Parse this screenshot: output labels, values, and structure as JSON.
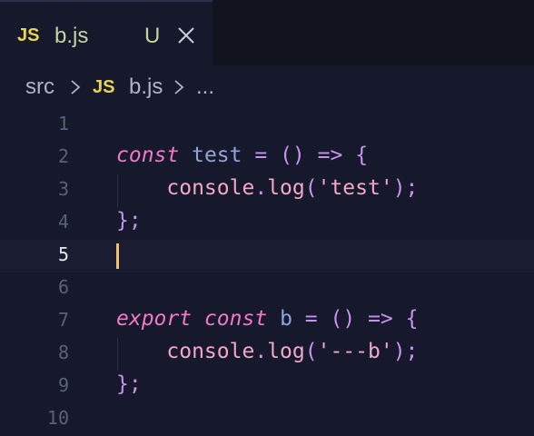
{
  "tab": {
    "file_icon": "JS",
    "file_name": "b.js",
    "status_badge": "U",
    "close_icon": "close-icon"
  },
  "breadcrumb": {
    "folder": "src",
    "file_icon": "JS",
    "file": "b.js",
    "more": "..."
  },
  "editor": {
    "current_line": 5,
    "lines": [
      {
        "number": "1",
        "text": ""
      },
      {
        "number": "2",
        "text": "const test = () => {"
      },
      {
        "number": "3",
        "text": "    console.log('test');"
      },
      {
        "number": "4",
        "text": "};"
      },
      {
        "number": "5",
        "text": ""
      },
      {
        "number": "6",
        "text": ""
      },
      {
        "number": "7",
        "text": "export const b = () => {"
      },
      {
        "number": "8",
        "text": "    console.log('---b');"
      },
      {
        "number": "9",
        "text": "};"
      },
      {
        "number": "10",
        "text": ""
      }
    ]
  },
  "colors": {
    "background": "#16192b",
    "keyword": "#f178c6",
    "identifier": "#8fa3d6",
    "string": "#f3a6c8",
    "js_icon": "#e8d44d",
    "untracked_badge": "#c6d3a0",
    "cursor": "#e8c07d"
  }
}
